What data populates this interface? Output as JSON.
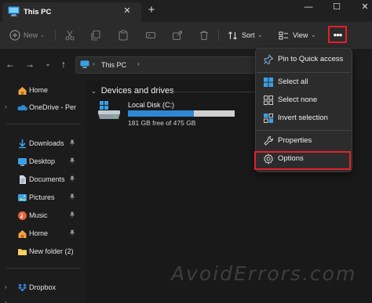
{
  "tab": {
    "title": "This PC",
    "close_glyph": "✕",
    "add_glyph": "+"
  },
  "window": {
    "minimize_glyph": "—",
    "maximize_glyph": "☐",
    "close_glyph": "✕"
  },
  "command_bar": {
    "new_label": "New",
    "sort_label": "Sort",
    "view_label": "View",
    "more_glyph": "•••",
    "chevron": "⌄"
  },
  "address": {
    "path": "This PC",
    "separator": "›"
  },
  "nav": {
    "back": "←",
    "forward": "→",
    "recent": "⌄",
    "up": "↑"
  },
  "sidebar": {
    "items": [
      {
        "label": "Home",
        "icon": "home-icon",
        "chevron": "",
        "pinned": false
      },
      {
        "label": "OneDrive - Perso",
        "icon": "onedrive-icon",
        "chevron": "›",
        "pinned": false
      },
      {
        "label": "Downloads",
        "icon": "downloads-icon",
        "chevron": "",
        "pinned": true
      },
      {
        "label": "Desktop",
        "icon": "desktop-icon",
        "chevron": "",
        "pinned": true
      },
      {
        "label": "Documents",
        "icon": "documents-icon",
        "chevron": "",
        "pinned": true
      },
      {
        "label": "Pictures",
        "icon": "pictures-icon",
        "chevron": "",
        "pinned": true
      },
      {
        "label": "Music",
        "icon": "music-icon",
        "chevron": "",
        "pinned": true
      },
      {
        "label": "Home",
        "icon": "home-icon",
        "chevron": "",
        "pinned": true
      },
      {
        "label": "New folder (2)",
        "icon": "folder-icon",
        "chevron": "",
        "pinned": false
      },
      {
        "label": "Dropbox",
        "icon": "dropbox-icon",
        "chevron": "›",
        "pinned": false
      }
    ],
    "pin_glyph": "📌"
  },
  "main": {
    "group_title": "Devices and drives",
    "group_chevron": "⌄",
    "drives": [
      {
        "name": "Local Disk (C:)",
        "free_text": "181 GB free of 475 GB",
        "used_fraction": 0.62
      }
    ]
  },
  "menu": {
    "items": [
      {
        "label": "Pin to Quick access",
        "icon": "pin-icon"
      },
      {
        "label": "Select all",
        "icon": "select-all-icon"
      },
      {
        "label": "Select none",
        "icon": "select-none-icon"
      },
      {
        "label": "Invert selection",
        "icon": "invert-selection-icon"
      },
      {
        "label": "Properties",
        "icon": "properties-icon"
      },
      {
        "label": "Options",
        "icon": "options-icon"
      }
    ]
  },
  "colors": {
    "accent_blue": "#2f87d6",
    "highlight_red": "#e2202a",
    "folder_yellow": "#f0c14b"
  },
  "watermark": "AvoidErrors.com"
}
